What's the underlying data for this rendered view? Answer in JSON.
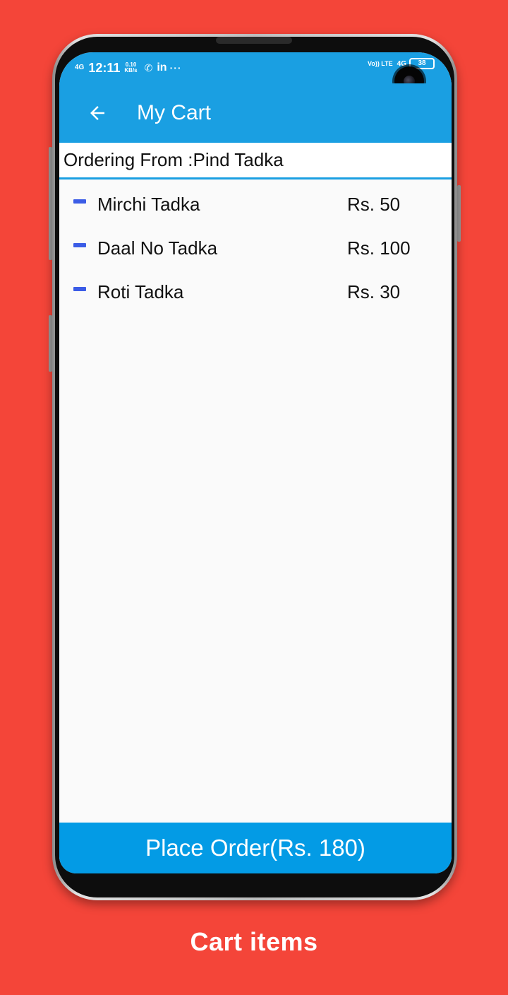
{
  "status_bar": {
    "network_left": "4G",
    "time": "12:11",
    "speed_value": "0.10",
    "speed_unit": "KB/s",
    "whatsapp_icon": "whatsapp-icon",
    "linkedin": "in",
    "more": "···",
    "volte": "Vo)) LTE",
    "network_right": "4G",
    "battery": "38"
  },
  "app_bar": {
    "title": "My Cart",
    "back_icon": "arrow-left-icon"
  },
  "ordering_from": "Ordering From :Pind Tadka",
  "cart_items": [
    {
      "name": "Mirchi Tadka",
      "price": "Rs. 50"
    },
    {
      "name": "Daal No Tadka",
      "price": "Rs. 100"
    },
    {
      "name": "Roti Tadka",
      "price": "Rs. 30"
    }
  ],
  "place_order_label": "Place Order(Rs. 180)",
  "caption": "Cart items",
  "colors": {
    "background": "#f44539",
    "app_bar": "#1a9fe2",
    "button": "#039be5",
    "remove_icon": "#3b5ce6"
  }
}
